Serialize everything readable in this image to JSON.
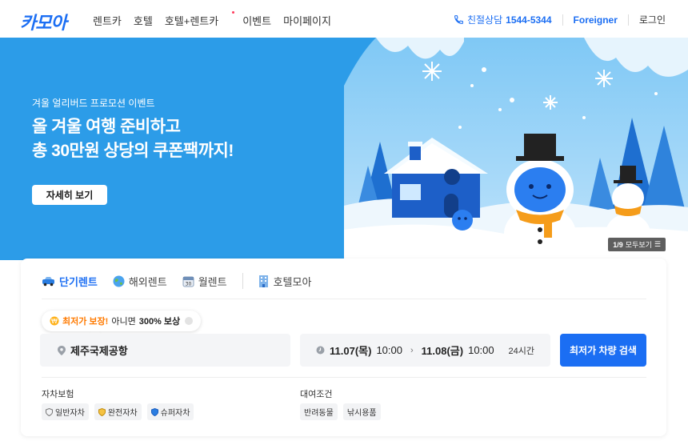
{
  "header": {
    "logo": "카모아",
    "nav": [
      "렌트카",
      "호텔",
      "호텔+렌트카",
      "이벤트",
      "마이페이지"
    ],
    "phone_label": "친절상담",
    "phone_number": "1544-5344",
    "foreigner": "Foreigner",
    "login": "로그인"
  },
  "banner": {
    "subtitle": "겨울 얼리버드 프로모션 이벤트",
    "title_line1": "올 겨울 여행 준비하고",
    "title_line2": "총 30만원 상당의 쿠폰팩까지!",
    "button": "자세히 보기",
    "pager_current": "1/9",
    "pager_all": "모두보기"
  },
  "search": {
    "tabs": [
      {
        "label": "단기렌트",
        "icon": "car-icon"
      },
      {
        "label": "해외렌트",
        "icon": "globe-icon"
      },
      {
        "label": "월렌트",
        "icon": "calendar-30-icon"
      },
      {
        "label": "호텔모아",
        "icon": "hotel-building-icon"
      }
    ],
    "guarantee_highlight": "최저가 보장!",
    "guarantee_text": "아니면",
    "guarantee_bold": "300% 보상",
    "place": "제주국제공항",
    "date_from": "11.07(목)",
    "time_from": "10:00",
    "date_to": "11.08(금)",
    "time_to": "10:00",
    "duration": "24시간",
    "search_button": "최저가 차량 검색",
    "insurance_label": "자차보험",
    "insurance_options": [
      "일반자차",
      "완전자차",
      "슈퍼자차"
    ],
    "conditions_label": "대여조건",
    "conditions_options": [
      "반려동물",
      "낚시용품"
    ]
  },
  "colors": {
    "brand": "#1b6ef3",
    "banner_bg": "#2c9ce8",
    "accent_orange": "#ff7a00"
  }
}
